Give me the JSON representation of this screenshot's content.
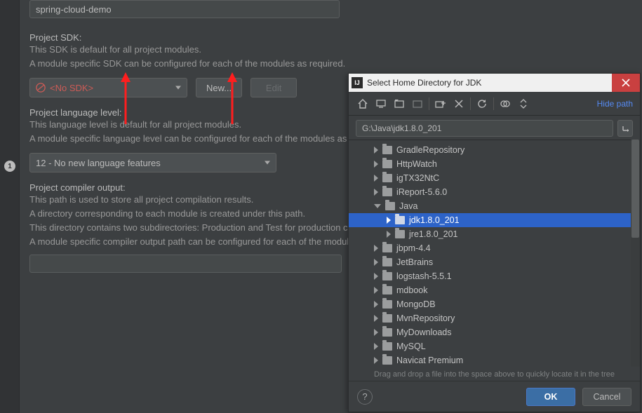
{
  "gutter_badge": "1",
  "project_name_field": "spring-cloud-demo",
  "sdk": {
    "label": "Project SDK:",
    "desc1": "This SDK is default for all project modules.",
    "desc2": "A module specific SDK can be configured for each of the modules as required.",
    "combo_value": "<No SDK>",
    "new_btn": "New...",
    "edit_btn": "Edit"
  },
  "language_level": {
    "label": "Project language level:",
    "desc1": "This language level is default for all project modules.",
    "desc2": "A module specific language level can be configured for each of the modules as required.",
    "combo_value": "12 - No new language features"
  },
  "compiler_out": {
    "label": "Project compiler output:",
    "desc1": "This path is used to store all project compilation results.",
    "desc2": "A directory corresponding to each module is created under this path.",
    "desc3": "This directory contains two subdirectories: Production and Test for production code and test sources, respectively.",
    "desc4": "A module specific compiler output path can be configured for each of the modules as required."
  },
  "dialog": {
    "title": "Select Home Directory for JDK",
    "hide_path": "Hide path",
    "path_value": "G:\\Java\\jdk1.8.0_201",
    "tree": [
      {
        "depth": 1,
        "expanded": false,
        "label": "GradleRepository",
        "selected": false
      },
      {
        "depth": 1,
        "expanded": false,
        "label": "HttpWatch",
        "selected": false
      },
      {
        "depth": 1,
        "expanded": false,
        "label": "igTX32NtC",
        "selected": false
      },
      {
        "depth": 1,
        "expanded": false,
        "label": "iReport-5.6.0",
        "selected": false
      },
      {
        "depth": 1,
        "expanded": true,
        "label": "Java",
        "selected": false
      },
      {
        "depth": 2,
        "expanded": false,
        "label": "jdk1.8.0_201",
        "selected": true
      },
      {
        "depth": 2,
        "expanded": false,
        "label": "jre1.8.0_201",
        "selected": false
      },
      {
        "depth": 1,
        "expanded": false,
        "label": "jbpm-4.4",
        "selected": false
      },
      {
        "depth": 1,
        "expanded": false,
        "label": "JetBrains",
        "selected": false
      },
      {
        "depth": 1,
        "expanded": false,
        "label": "logstash-5.5.1",
        "selected": false
      },
      {
        "depth": 1,
        "expanded": false,
        "label": "mdbook",
        "selected": false
      },
      {
        "depth": 1,
        "expanded": false,
        "label": "MongoDB",
        "selected": false
      },
      {
        "depth": 1,
        "expanded": false,
        "label": "MvnRepository",
        "selected": false
      },
      {
        "depth": 1,
        "expanded": false,
        "label": "MyDownloads",
        "selected": false
      },
      {
        "depth": 1,
        "expanded": false,
        "label": "MySQL",
        "selected": false
      },
      {
        "depth": 1,
        "expanded": false,
        "label": "Navicat Premium",
        "selected": false
      }
    ],
    "hint": "Drag and drop a file into the space above to quickly locate it in the tree",
    "ok": "OK",
    "cancel": "Cancel"
  }
}
